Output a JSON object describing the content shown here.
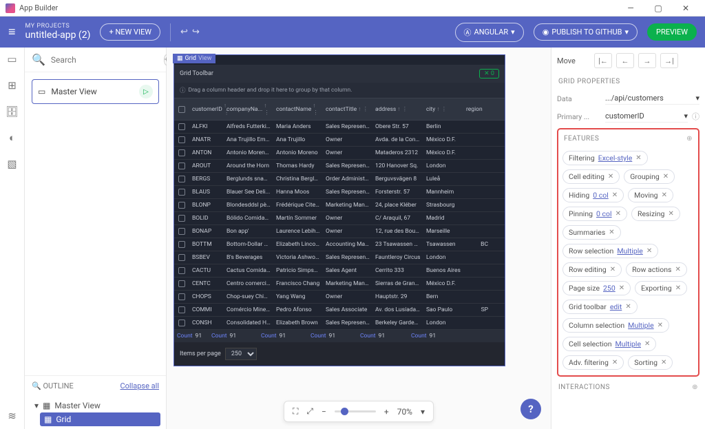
{
  "window": {
    "title": "App Builder"
  },
  "topbar": {
    "projects_label": "MY PROJECTS",
    "project_name": "untitled-app (2)",
    "new_view": "+ NEW VIEW",
    "framework": "ANGULAR",
    "publish": "PUBLISH TO GITHUB",
    "preview": "PREVIEW"
  },
  "left": {
    "search_placeholder": "Search",
    "master_view": "Master View",
    "outline_label": "OUTLINE",
    "collapse_all": "Collapse all",
    "tree_root": "Master View",
    "tree_child": "Grid"
  },
  "canvas": {
    "tab_label": "Grid",
    "tab_suffix": "View",
    "toolbar_title": "Grid Toolbar",
    "chip0": "✕ 0",
    "group_hint": "Drag a column header and drop it here to group by that column.",
    "columns": [
      "customerID",
      "companyNa...",
      "contactName",
      "contactTitle",
      "address",
      "city",
      "region"
    ],
    "rows": [
      {
        "id": "ALFKI",
        "co": "Alfreds Futterkiste",
        "cn": "Maria Anders",
        "ct": "Sales Represent...",
        "ad": "Obere Str. 57",
        "ci": "Berlin",
        "re": ""
      },
      {
        "id": "ANATR",
        "co": "Ana Trujillo Empa...",
        "cn": "Ana Trujillo",
        "ct": "Owner",
        "ad": "Avda. de la Const...",
        "ci": "México D.F.",
        "re": ""
      },
      {
        "id": "ANTON",
        "co": "Antonio Moreno ...",
        "cn": "Antonio Moreno",
        "ct": "Owner",
        "ad": "Mataderos 2312",
        "ci": "México D.F.",
        "re": ""
      },
      {
        "id": "AROUT",
        "co": "Around the Horn",
        "cn": "Thomas Hardy",
        "ct": "Sales Represent...",
        "ad": "120 Hanover Sq.",
        "ci": "London",
        "re": ""
      },
      {
        "id": "BERGS",
        "co": "Berglunds snabb...",
        "cn": "Christina Berglund",
        "ct": "Order Administra...",
        "ad": "Berguvsvägen 8",
        "ci": "Luleå",
        "re": ""
      },
      {
        "id": "BLAUS",
        "co": "Blauer See Deli...",
        "cn": "Hanna Moos",
        "ct": "Sales Represent...",
        "ad": "Forsterstr. 57",
        "ci": "Mannheim",
        "re": ""
      },
      {
        "id": "BLONP",
        "co": "Blondesddsl père...",
        "cn": "Frédérique Citeaux",
        "ct": "Marketing Mana...",
        "ad": "24, place Kléber",
        "ci": "Strasbourg",
        "re": ""
      },
      {
        "id": "BOLID",
        "co": "Bólido Comidas p...",
        "cn": "Martín Sommer",
        "ct": "Owner",
        "ad": "C/ Araquil, 67",
        "ci": "Madrid",
        "re": ""
      },
      {
        "id": "BONAP",
        "co": "Bon app'",
        "cn": "Laurence Lebihan",
        "ct": "Owner",
        "ad": "12, rue des Bouc...",
        "ci": "Marseille",
        "re": ""
      },
      {
        "id": "BOTTM",
        "co": "Bottom-Dollar M...",
        "cn": "Elizabeth Lincoln",
        "ct": "Accounting Mana...",
        "ad": "23 Tsawassen Bl...",
        "ci": "Tsawassen",
        "re": "BC"
      },
      {
        "id": "BSBEV",
        "co": "B's Beverages",
        "cn": "Victoria Ashworth",
        "ct": "Sales Represent...",
        "ad": "Fauntleroy Circus",
        "ci": "London",
        "re": ""
      },
      {
        "id": "CACTU",
        "co": "Cactus Comidas ...",
        "cn": "Patricio Simpson",
        "ct": "Sales Agent",
        "ad": "Cerrito 333",
        "ci": "Buenos Aires",
        "re": ""
      },
      {
        "id": "CENTC",
        "co": "Centro comercial ...",
        "cn": "Francisco Chang",
        "ct": "Marketing Mana...",
        "ad": "Sierras de Grana...",
        "ci": "México D.F.",
        "re": ""
      },
      {
        "id": "CHOPS",
        "co": "Chop-suey Chine...",
        "cn": "Yang Wang",
        "ct": "Owner",
        "ad": "Hauptstr. 29",
        "ci": "Bern",
        "re": ""
      },
      {
        "id": "COMMI",
        "co": "Comércio Mineiro",
        "cn": "Pedro Afonso",
        "ct": "Sales Associate",
        "ad": "Av. dos Lusíadas,...",
        "ci": "Sao Paulo",
        "re": "SP"
      },
      {
        "id": "CONSH",
        "co": "Consolidated Hol...",
        "cn": "Elizabeth Brown",
        "ct": "Sales Represent...",
        "ad": "Berkeley Garden...",
        "ci": "London",
        "re": ""
      }
    ],
    "footer_label": "Count",
    "footer_value": "91",
    "items_per_page": "Items per page",
    "page_size": "250",
    "zoom": "70%"
  },
  "right": {
    "move_label": "Move",
    "grid_props": "GRID PROPERTIES",
    "data_label": "Data",
    "data_value": ".../api/customers",
    "primary_label": "Primary ...",
    "primary_value": "customerID",
    "features_label": "FEATURES",
    "chips": [
      {
        "name": "Filtering",
        "link": "Excel-style",
        "x": true
      },
      {
        "name": "Cell editing",
        "x": true
      },
      {
        "name": "Grouping",
        "x": true
      },
      {
        "name": "Hiding",
        "link": "0 col",
        "x": true
      },
      {
        "name": "Moving",
        "x": true
      },
      {
        "name": "Pinning",
        "link": "0 col",
        "x": true
      },
      {
        "name": "Resizing",
        "x": true
      },
      {
        "name": "Summaries",
        "x": true
      },
      {
        "name": "Row selection",
        "link": "Multiple",
        "x": true
      },
      {
        "name": "Row editing",
        "x": true
      },
      {
        "name": "Row actions",
        "x": true
      },
      {
        "name": "Page size",
        "link": "250",
        "x": true
      },
      {
        "name": "Exporting",
        "x": true
      },
      {
        "name": "Grid toolbar",
        "link": "edit",
        "x": true
      },
      {
        "name": "Column selection",
        "link": "Multiple",
        "x": true
      },
      {
        "name": "Cell selection",
        "link": "Multiple",
        "x": true
      },
      {
        "name": "Adv. filtering",
        "x": true
      },
      {
        "name": "Sorting",
        "x": true
      }
    ],
    "interactions_label": "INTERACTIONS"
  }
}
